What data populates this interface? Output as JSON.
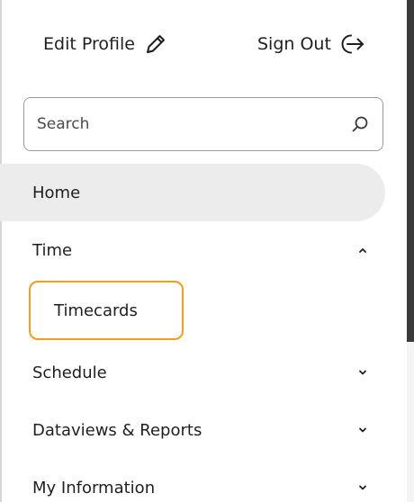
{
  "header": {
    "edit_profile_label": "Edit Profile",
    "sign_out_label": "Sign Out"
  },
  "search": {
    "placeholder": "Search",
    "value": ""
  },
  "nav": {
    "home_label": "Home",
    "time_label": "Time",
    "timecards_label": "Timecards",
    "schedule_label": "Schedule",
    "dataviews_label": "Dataviews & Reports",
    "my_information_label": "My Information"
  },
  "icons": {
    "edit": "pencil-icon",
    "sign_out": "sign-out-arrow-icon",
    "search": "magnifier-icon",
    "expanded": "chevron-up-icon",
    "collapsed": "chevron-down-icon"
  },
  "colors": {
    "highlight_border": "#f59e1b",
    "active_background": "#ececec"
  }
}
